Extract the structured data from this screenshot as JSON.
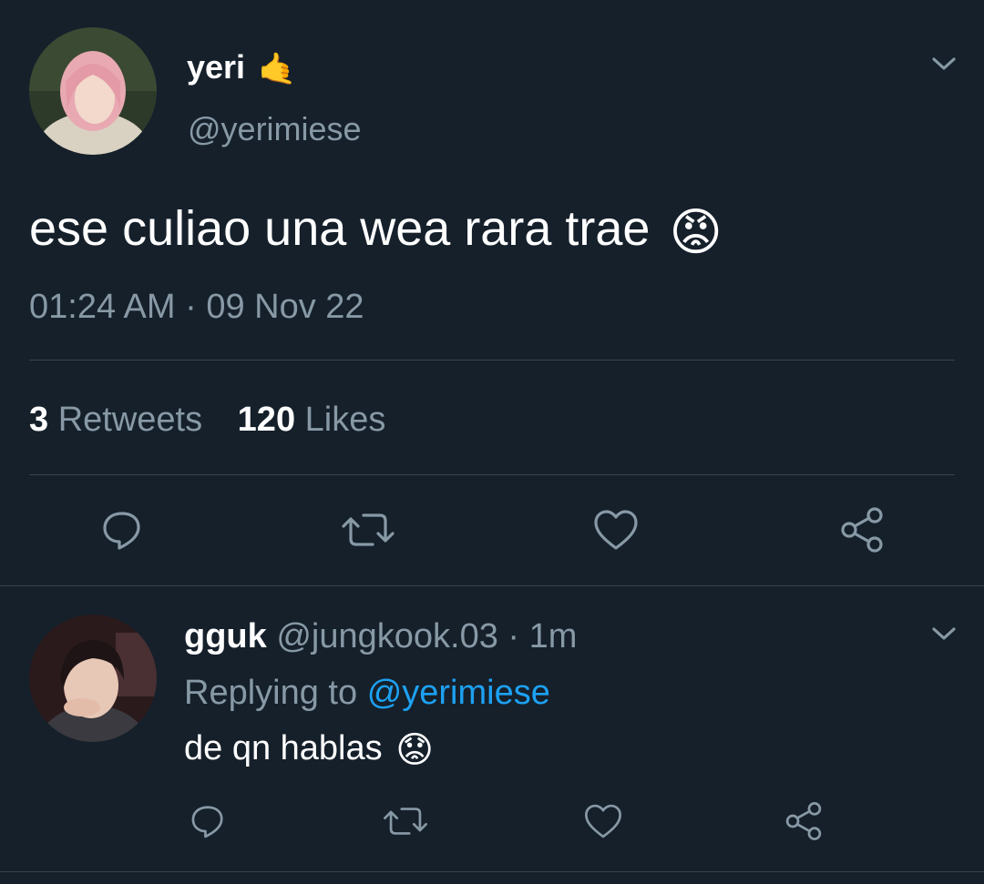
{
  "tweet": {
    "author_name": "yeri",
    "author_emoji": "🤙",
    "author_handle": "@yerimiese",
    "text": "ese culiao una wea rara trae",
    "text_emoji": "😡",
    "time": "01:24 AM",
    "separator": "·",
    "date": "09 Nov 22",
    "retweets_count": "3",
    "retweets_label": "Retweets",
    "likes_count": "120",
    "likes_label": "Likes",
    "actions": [
      "reply-icon",
      "retweet-icon",
      "like-icon",
      "share-icon"
    ]
  },
  "reply": {
    "author_name": "gguk",
    "author_handle": "@jungkook.03",
    "separator": "·",
    "time": "1m",
    "replying_prefix": "Replying to",
    "replying_handle": "@yerimiese",
    "text": "de qn hablas",
    "text_emoji": "😟",
    "actions": [
      "reply-icon",
      "retweet-icon",
      "like-icon",
      "share-icon"
    ]
  },
  "colors": {
    "background": "#15202b",
    "text": "#ffffff",
    "muted": "#8899a6",
    "accent": "#1da1f2",
    "divider": "#38444d"
  }
}
